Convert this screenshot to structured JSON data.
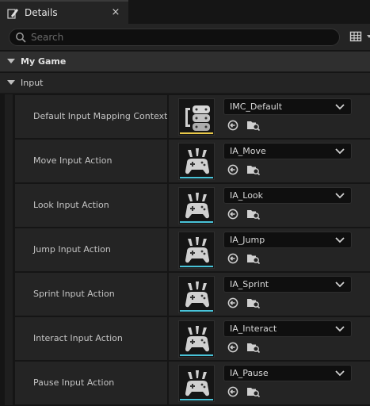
{
  "tab": {
    "title": "Details",
    "icon": "pencil-icon",
    "close": "×"
  },
  "search": {
    "placeholder": "Search"
  },
  "categories": [
    {
      "label": "My Game"
    },
    {
      "label": "Input"
    }
  ],
  "rows": [
    {
      "label": "Default Input Mapping Context",
      "asset": "IMC_Default",
      "thumb": "input-mapping-context-icon",
      "accent": "#e8c84a"
    },
    {
      "label": "Move Input Action",
      "asset": "IA_Move",
      "thumb": "input-action-icon",
      "accent": "#49c3d8"
    },
    {
      "label": "Look Input Action",
      "asset": "IA_Look",
      "thumb": "input-action-icon",
      "accent": "#49c3d8"
    },
    {
      "label": "Jump Input Action",
      "asset": "IA_Jump",
      "thumb": "input-action-icon",
      "accent": "#49c3d8"
    },
    {
      "label": "Sprint Input Action",
      "asset": "IA_Sprint",
      "thumb": "input-action-icon",
      "accent": "#49c3d8"
    },
    {
      "label": "Interact Input Action",
      "asset": "IA_Interact",
      "thumb": "input-action-icon",
      "accent": "#49c3d8"
    },
    {
      "label": "Pause Input Action",
      "asset": "IA_Pause",
      "thumb": "input-action-icon",
      "accent": "#49c3d8"
    }
  ]
}
